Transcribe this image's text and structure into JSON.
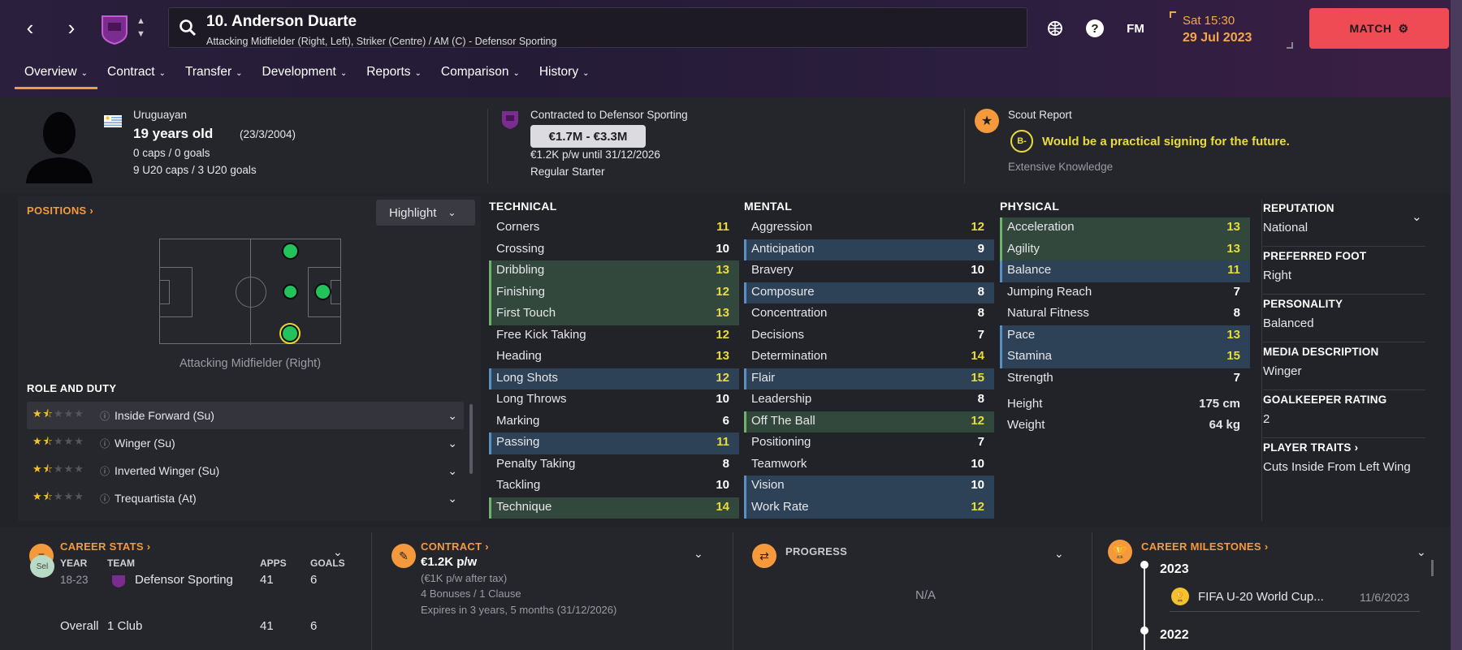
{
  "header": {
    "player_title": "10. Anderson Duarte",
    "player_subtitle": "Attacking Midfielder (Right, Left), Striker (Centre) / AM (C) - Defensor Sporting",
    "fm_label": "FM",
    "date_day": "Sat 15:30",
    "date": "29 Jul 2023",
    "match_label": "MATCH"
  },
  "tabs": [
    {
      "label": "Overview"
    },
    {
      "label": "Contract"
    },
    {
      "label": "Transfer"
    },
    {
      "label": "Development"
    },
    {
      "label": "Reports"
    },
    {
      "label": "Comparison"
    },
    {
      "label": "History"
    }
  ],
  "bio": {
    "nationality": "Uruguayan",
    "age": "19 years old",
    "dob": "(23/3/2004)",
    "caps": "0 caps / 0 goals",
    "u20": "9 U20 caps / 3 U20 goals"
  },
  "contract_summary": {
    "label": "Contracted to Defensor Sporting",
    "value_range": "€1.7M - €3.3M",
    "wage": "€1.2K p/w until 31/12/2026",
    "status": "Regular Starter"
  },
  "scout": {
    "label": "Scout Report",
    "grade": "B-",
    "verdict": "Would be a practical signing for the future.",
    "knowledge": "Extensive Knowledge"
  },
  "positions": {
    "title": "POSITIONS",
    "highlight_label": "Highlight",
    "current_position": "Attacking Midfielder (Right)"
  },
  "roles": {
    "title": "ROLE AND DUTY",
    "items": [
      {
        "label": "Inside Forward (Su)",
        "stars": 1.5
      },
      {
        "label": "Winger (Su)",
        "stars": 1.5
      },
      {
        "label": "Inverted Winger (Su)",
        "stars": 1.5
      },
      {
        "label": "Trequartista (At)",
        "stars": 1.5
      }
    ]
  },
  "technical": {
    "title": "TECHNICAL",
    "items": [
      {
        "name": "Corners",
        "value": "11",
        "hl": "",
        "color": "yellow"
      },
      {
        "name": "Crossing",
        "value": "10",
        "hl": "",
        "color": "white"
      },
      {
        "name": "Dribbling",
        "value": "13",
        "hl": "g",
        "color": "yellow"
      },
      {
        "name": "Finishing",
        "value": "12",
        "hl": "g",
        "color": "yellow"
      },
      {
        "name": "First Touch",
        "value": "13",
        "hl": "g",
        "color": "yellow"
      },
      {
        "name": "Free Kick Taking",
        "value": "12",
        "hl": "",
        "color": "yellow"
      },
      {
        "name": "Heading",
        "value": "13",
        "hl": "",
        "color": "yellow"
      },
      {
        "name": "Long Shots",
        "value": "12",
        "hl": "b",
        "color": "yellow"
      },
      {
        "name": "Long Throws",
        "value": "10",
        "hl": "",
        "color": "white"
      },
      {
        "name": "Marking",
        "value": "6",
        "hl": "",
        "color": "white"
      },
      {
        "name": "Passing",
        "value": "11",
        "hl": "b",
        "color": "yellow"
      },
      {
        "name": "Penalty Taking",
        "value": "8",
        "hl": "",
        "color": "white"
      },
      {
        "name": "Tackling",
        "value": "10",
        "hl": "",
        "color": "white"
      },
      {
        "name": "Technique",
        "value": "14",
        "hl": "g",
        "color": "yellow"
      }
    ]
  },
  "mental": {
    "title": "MENTAL",
    "items": [
      {
        "name": "Aggression",
        "value": "12",
        "hl": "",
        "color": "yellow"
      },
      {
        "name": "Anticipation",
        "value": "9",
        "hl": "b",
        "color": "white"
      },
      {
        "name": "Bravery",
        "value": "10",
        "hl": "",
        "color": "white"
      },
      {
        "name": "Composure",
        "value": "8",
        "hl": "b",
        "color": "white"
      },
      {
        "name": "Concentration",
        "value": "8",
        "hl": "",
        "color": "white"
      },
      {
        "name": "Decisions",
        "value": "7",
        "hl": "",
        "color": "white"
      },
      {
        "name": "Determination",
        "value": "14",
        "hl": "",
        "color": "yellow"
      },
      {
        "name": "Flair",
        "value": "15",
        "hl": "b",
        "color": "yellow"
      },
      {
        "name": "Leadership",
        "value": "8",
        "hl": "",
        "color": "white"
      },
      {
        "name": "Off The Ball",
        "value": "12",
        "hl": "g",
        "color": "yellow"
      },
      {
        "name": "Positioning",
        "value": "7",
        "hl": "",
        "color": "white"
      },
      {
        "name": "Teamwork",
        "value": "10",
        "hl": "",
        "color": "white"
      },
      {
        "name": "Vision",
        "value": "10",
        "hl": "b",
        "color": "white"
      },
      {
        "name": "Work Rate",
        "value": "12",
        "hl": "b",
        "color": "yellow"
      }
    ]
  },
  "physical": {
    "title": "PHYSICAL",
    "items": [
      {
        "name": "Acceleration",
        "value": "13",
        "hl": "g",
        "color": "yellow"
      },
      {
        "name": "Agility",
        "value": "13",
        "hl": "g",
        "color": "yellow"
      },
      {
        "name": "Balance",
        "value": "11",
        "hl": "b",
        "color": "yellow"
      },
      {
        "name": "Jumping Reach",
        "value": "7",
        "hl": "",
        "color": "white"
      },
      {
        "name": "Natural Fitness",
        "value": "8",
        "hl": "",
        "color": "white"
      },
      {
        "name": "Pace",
        "value": "13",
        "hl": "b",
        "color": "yellow"
      },
      {
        "name": "Stamina",
        "value": "15",
        "hl": "b",
        "color": "yellow"
      },
      {
        "name": "Strength",
        "value": "7",
        "hl": "",
        "color": "white"
      }
    ],
    "height_label": "Height",
    "height": "175 cm",
    "weight_label": "Weight",
    "weight": "64 kg"
  },
  "info": {
    "reputation_h": "REPUTATION",
    "reputation": "National",
    "foot_h": "PREFERRED FOOT",
    "foot": "Right",
    "personality_h": "PERSONALITY",
    "personality": "Balanced",
    "media_h": "MEDIA DESCRIPTION",
    "media": "Winger",
    "gk_h": "GOALKEEPER RATING",
    "gk": "2",
    "traits_h": "PLAYER TRAITS",
    "traits": "Cuts Inside From Left Wing"
  },
  "career_stats": {
    "title": "CAREER STATS",
    "badge": "Sel",
    "col_year": "YEAR",
    "col_team": "TEAM",
    "col_apps": "APPS",
    "col_goals": "GOALS",
    "row_year": "18-23",
    "row_team": "Defensor Sporting",
    "row_apps": "41",
    "row_goals": "6",
    "total_label": "Overall",
    "total_team": "1 Club",
    "total_apps": "41",
    "total_goals": "6"
  },
  "contract": {
    "title": "CONTRACT",
    "wage": "€1.2K p/w",
    "after_tax": "(€1K p/w after tax)",
    "bonuses": "4 Bonuses / 1 Clause",
    "expires": "Expires in 3 years, 5 months (31/12/2026)"
  },
  "progress": {
    "title": "PROGRESS",
    "value": "N/A"
  },
  "milestones": {
    "title": "CAREER MILESTONES",
    "year1": "2023",
    "item1": "FIFA U-20 World Cup...",
    "item1_date": "11/6/2023",
    "year2": "2022"
  },
  "colors": {
    "accent": "#f29a3d",
    "match_button": "#ef4b55",
    "highlight_good": "#33483d",
    "highlight_key": "#2d4257",
    "value_good": "#e9dc3a",
    "scout_text": "#e9dc3a"
  }
}
